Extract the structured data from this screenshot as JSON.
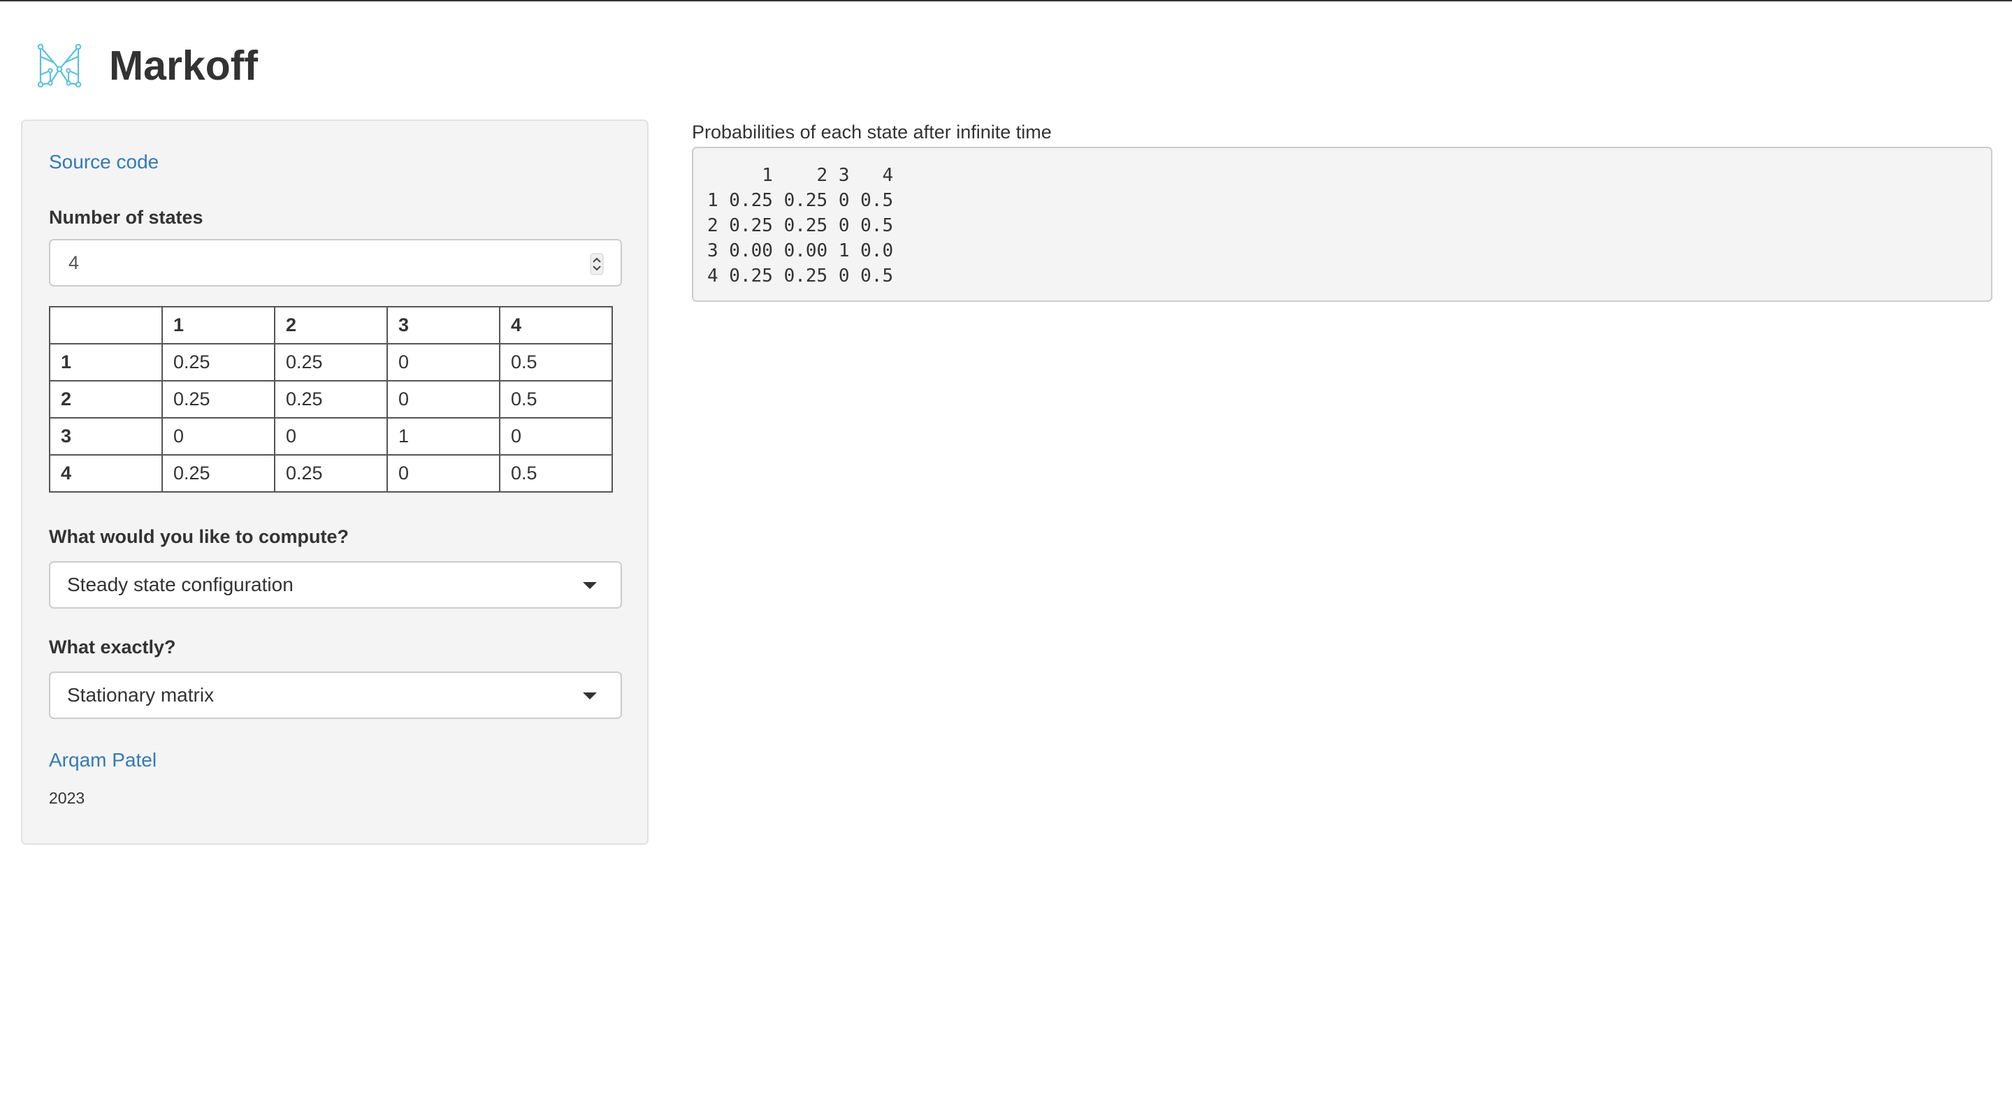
{
  "app": {
    "title": "Markoff",
    "logo_icon": "markov-graph-m-icon",
    "logo_color": "#5bc0de"
  },
  "sidebar": {
    "source_link": "Source code",
    "states_label": "Number of states",
    "states_value": "4",
    "matrix": {
      "headers": [
        "",
        "1",
        "2",
        "3",
        "4"
      ],
      "rows": [
        [
          "1",
          "0.25",
          "0.25",
          "0",
          "0.5"
        ],
        [
          "2",
          "0.25",
          "0.25",
          "0",
          "0.5"
        ],
        [
          "3",
          "0",
          "0",
          "1",
          "0"
        ],
        [
          "4",
          "0.25",
          "0.25",
          "0",
          "0.5"
        ]
      ]
    },
    "compute_label": "What would you like to compute?",
    "compute_value": "Steady state configuration",
    "exact_label": "What exactly?",
    "exact_value": "Stationary matrix",
    "author_link": "Arqam Patel",
    "year": "2023"
  },
  "main": {
    "output_label": "Probabilities of each state after infinite time",
    "output_text": "     1    2 3   4\n1 0.25 0.25 0 0.5\n2 0.25 0.25 0 0.5\n3 0.00 0.00 1 0.0\n4 0.25 0.25 0 0.5"
  },
  "colors": {
    "link": "#337ab7",
    "panel_background": "#f4f4f4"
  }
}
